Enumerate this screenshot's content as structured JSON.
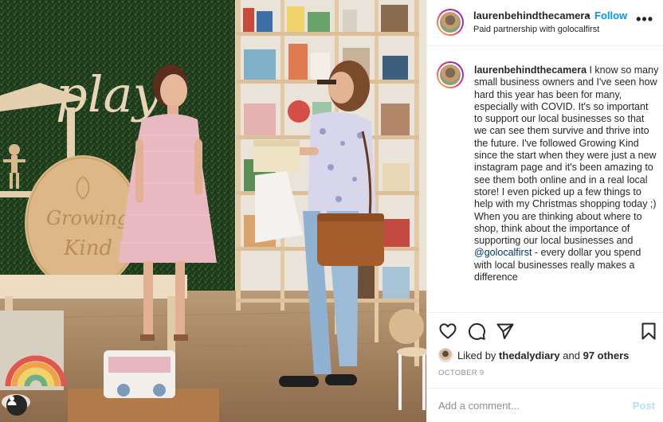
{
  "post": {
    "username": "laurenbehindthecamera",
    "follow_dot": "•",
    "follow_label": "Follow",
    "subtitle": "Paid partnership with golocalfirst",
    "more_label": "•••",
    "caption_username": "laurenbehindthecamera",
    "caption_text_1": " I know so many small business owners and I've seen how hard this year has been for many, especially with COVID. It's so important to support our local businesses so that we can see them survive and thrive into the future. I've followed Growing Kind since the start when they were just a new instagram page and it's been amazing to see them both online and in a real local store! I even picked up a few things to help with my Christmas shopping today ;)",
    "caption_text_2": "When you are thinking about where to shop, think about the importance of supporting our local businesses and ",
    "caption_mention": "@golocalfirst",
    "caption_text_3": " - every dollar you spend with local businesses really makes a difference",
    "liked_by_prefix": "Liked by ",
    "liked_by_user": "thedalydiary",
    "liked_by_and": " and ",
    "liked_by_count": "97 others",
    "date": "OCTOBER 9",
    "comment_placeholder": "Add a comment...",
    "post_label": "Post"
  },
  "photo": {
    "wall_sign": "play",
    "round_sign_line1": "Growing",
    "round_sign_line2": "Kind"
  },
  "icons": {
    "heart": "heart-icon",
    "comment": "comment-icon",
    "share": "share-icon",
    "save": "bookmark-icon",
    "tag": "user-tag-icon",
    "more": "more-options-icon"
  },
  "colors": {
    "link": "#0095f6",
    "post_disabled": "#b2dffc",
    "text": "#262626",
    "muted": "#8e8e8e"
  }
}
